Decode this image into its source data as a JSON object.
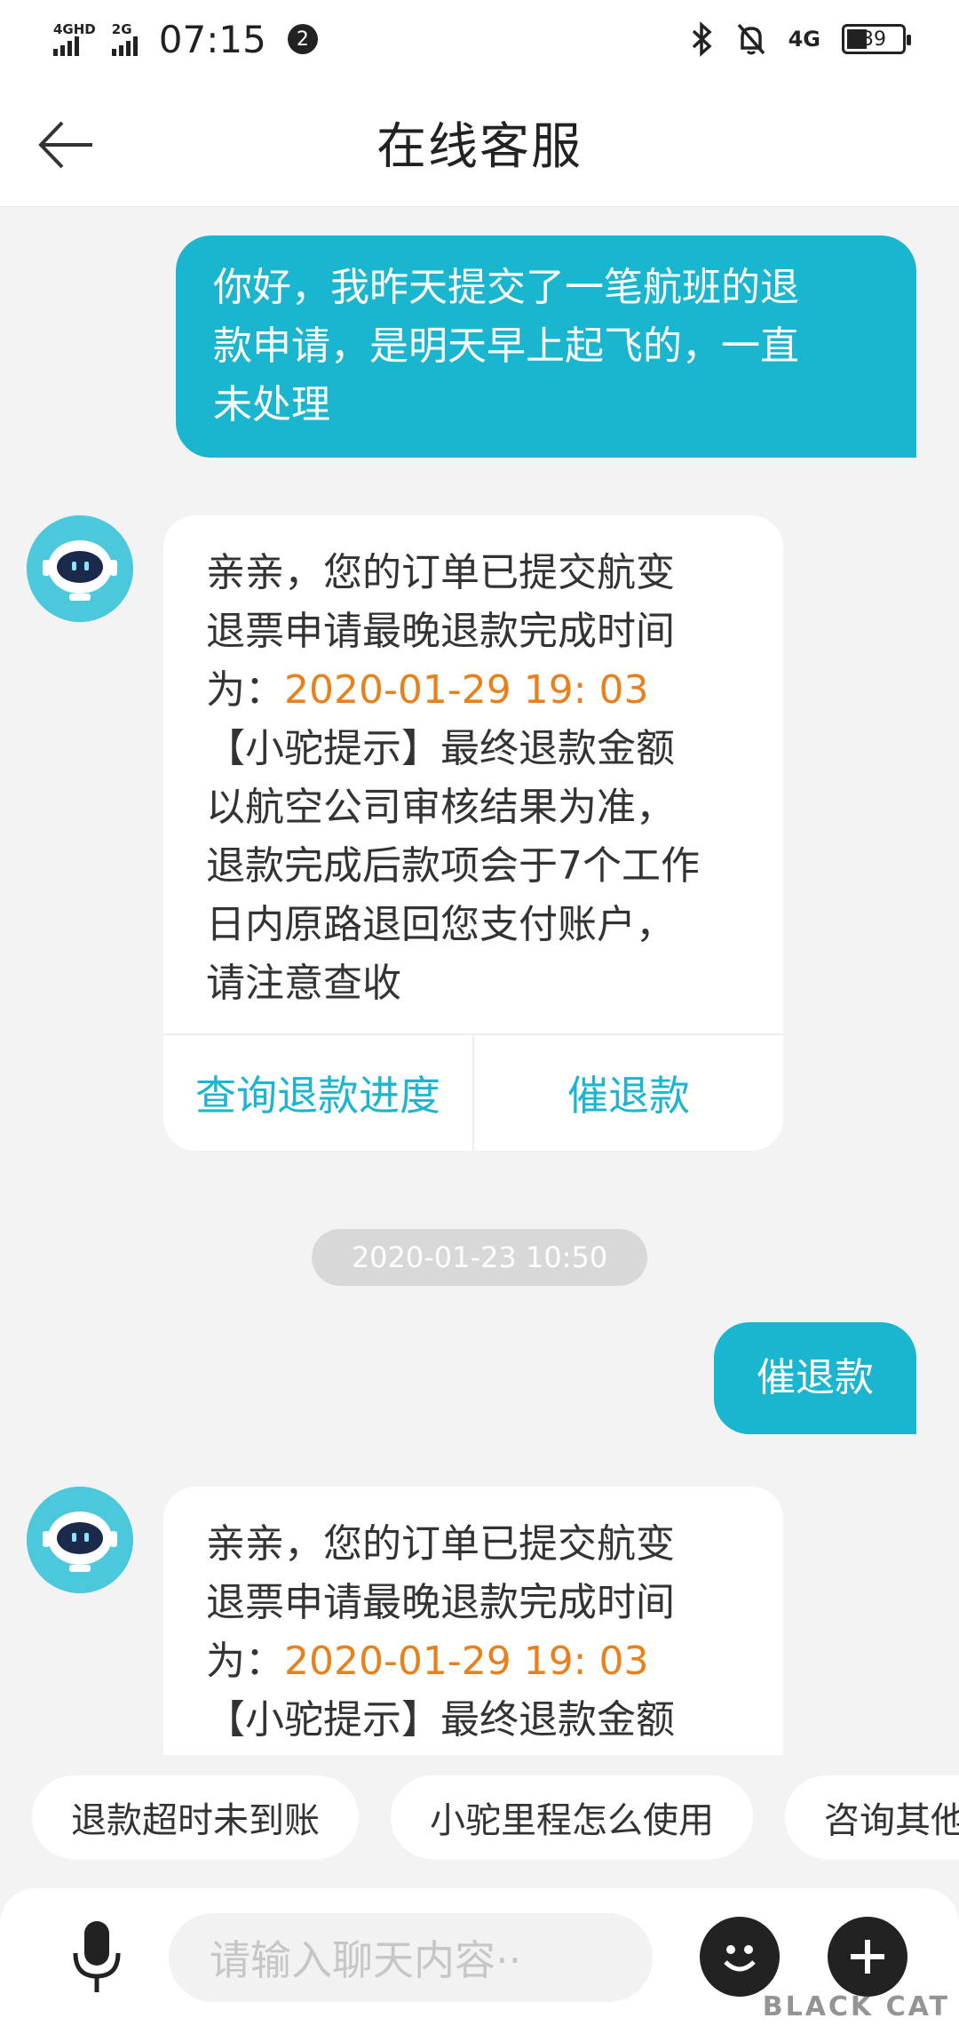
{
  "status_bar": {
    "net1": "4GHD",
    "net2": "2G",
    "time": "07:15",
    "notification_count": "2",
    "net3": "4G",
    "battery": "39"
  },
  "header": {
    "title": "在线客服"
  },
  "messages": {
    "user1": [
      "你好，我昨天提交了一笔航班的退",
      "款申请，是明天早上起飞的，一直",
      "未处理"
    ],
    "bot1": {
      "line1": "亲亲，您的订单已提交航变",
      "line2": "退票申请最晚退款完成时间",
      "line3_prefix": "为：",
      "line3_time": "2020-01-29 19: 03",
      "line4": "【小驼提示】最终退款金额",
      "line5": "以航空公司审核结果为准，",
      "line6": "退款完成后款项会于7个工作",
      "line7": "日内原路退回您支付账户，",
      "line8": "请注意查收",
      "action1": "查询退款进度",
      "action2": "催退款"
    },
    "timestamp": "2020-01-23 10:50",
    "user2": "催退款",
    "bot2": {
      "line1": "亲亲，您的订单已提交航变",
      "line2": "退票申请最晚退款完成时间",
      "line3_prefix": "为：",
      "line3_time": "2020-01-29 19: 03",
      "line4": "【小驼提示】最终退款金额"
    }
  },
  "quick_replies": [
    "退款超时未到账",
    "小驼里程怎么使用",
    "咨询其他"
  ],
  "input": {
    "placeholder": "请输入聊天内容··"
  },
  "watermark": "BLACK CAT",
  "icons": {
    "back": "back-arrow-icon",
    "avatar": "robot-avatar-icon",
    "mic": "microphone-icon",
    "emoji": "emoji-icon",
    "plus": "plus-icon"
  },
  "colors": {
    "accent": "#1ab5ce",
    "highlight": "#e8801c"
  }
}
